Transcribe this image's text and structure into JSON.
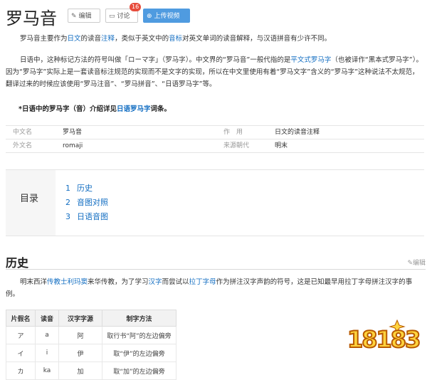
{
  "header": {
    "title": "罗马音",
    "edit_label": "编辑",
    "discuss_label": "讨论",
    "discuss_count": "16",
    "upload_label": "上传视频"
  },
  "intro": {
    "p1_a": "罗马音主要作为",
    "p1_link1": "日文",
    "p1_b": "的读音",
    "p1_link2": "注释",
    "p1_c": "，类似于英文中的",
    "p1_link3": "音标",
    "p1_d": "对英文单词的读音解释，与汉语拼音有少许不同。",
    "p2_a": "日语中，这种标记方法的符号叫做「ローマ字」（罗马字）。中文界的“罗马音”一般代指的是",
    "p2_link1": "平文式罗马字",
    "p2_b": "（也被译作“黑本式罗马字”）。因为“罗马字”实际上是一套读音标注规范的实现而不是文字的实现，所以在中文里使用有着“罗马文字”含义的“罗马字”这种说法不太规范，翻译过来的时候应该使用“罗马注音”、“罗马拼音”、“日语罗马字”等。",
    "p3_a": "*日语中的罗马字（音）介绍详见",
    "p3_link": "日语罗马字",
    "p3_b": "词条。"
  },
  "infobox": {
    "rows": [
      {
        "k1": "中文名",
        "v1": "罗马音",
        "k2": "作　用",
        "v2": "日文的读音注释"
      },
      {
        "k1": "外文名",
        "v1": "romaji",
        "k2": "来源朝代",
        "v2": "明末"
      }
    ]
  },
  "toc": {
    "title": "目录",
    "items": [
      {
        "num": "1",
        "label": "历史"
      },
      {
        "num": "2",
        "label": "音图对照"
      },
      {
        "num": "3",
        "label": "日语音图"
      }
    ]
  },
  "history": {
    "heading": "历史",
    "edit_label": "编辑",
    "p_a": "明末西洋",
    "p_link1": "传教士利玛窦",
    "p_b": "来华传教，为了学习",
    "p_link2": "汉字",
    "p_c": "而尝试以",
    "p_link3": "拉丁字母",
    "p_d": "作为拼注汉字声韵的符号，这是已知最早用拉丁字母拼注汉字的事例。"
  },
  "kana_table": {
    "headers": [
      "片假名",
      "读音",
      "汉字字源",
      "制字方法"
    ],
    "rows": [
      [
        "ア",
        "a",
        "阿",
        "取行书“阿”的左边偏旁"
      ],
      [
        "イ",
        "i",
        "伊",
        "取“伊”的左边偏旁"
      ],
      [
        "カ",
        "ka",
        "加",
        "取“加”的左边偏旁"
      ]
    ]
  },
  "watermark": {
    "text": "18183"
  },
  "colors": {
    "link": "#136ec2",
    "upload_btn": "#4f9be0",
    "badge": "#e74c3c"
  }
}
